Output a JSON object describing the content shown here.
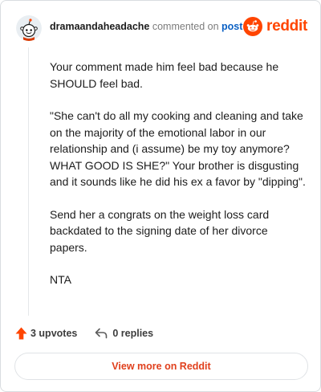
{
  "header": {
    "username": "dramaandaheadache",
    "verb": "commented on",
    "post_link": "post",
    "brand": "reddit"
  },
  "comment": {
    "paragraphs": [
      "Your comment made him feel bad because he SHOULD feel bad.",
      "\"She can't do all my cooking and cleaning and take on the majority of the emotional labor in our relationship and (i assume) be my toy anymore? WHAT GOOD IS SHE?\" Your brother is disgusting and it sounds like he did his ex a favor by \"dipping\".",
      "Send her a congrats on the weight loss card backdated to the signing date of her divorce papers.",
      "NTA"
    ]
  },
  "actions": {
    "upvotes": "3 upvotes",
    "replies": "0 replies"
  },
  "footer": {
    "view_more": "View more on Reddit"
  },
  "colors": {
    "brand": "#ff4500",
    "link": "#0a60c4",
    "upvote": "#ff4500"
  },
  "icons": [
    "user-avatar",
    "reddit-snoo-icon",
    "upvote-arrow-icon",
    "reply-arrow-icon"
  ]
}
